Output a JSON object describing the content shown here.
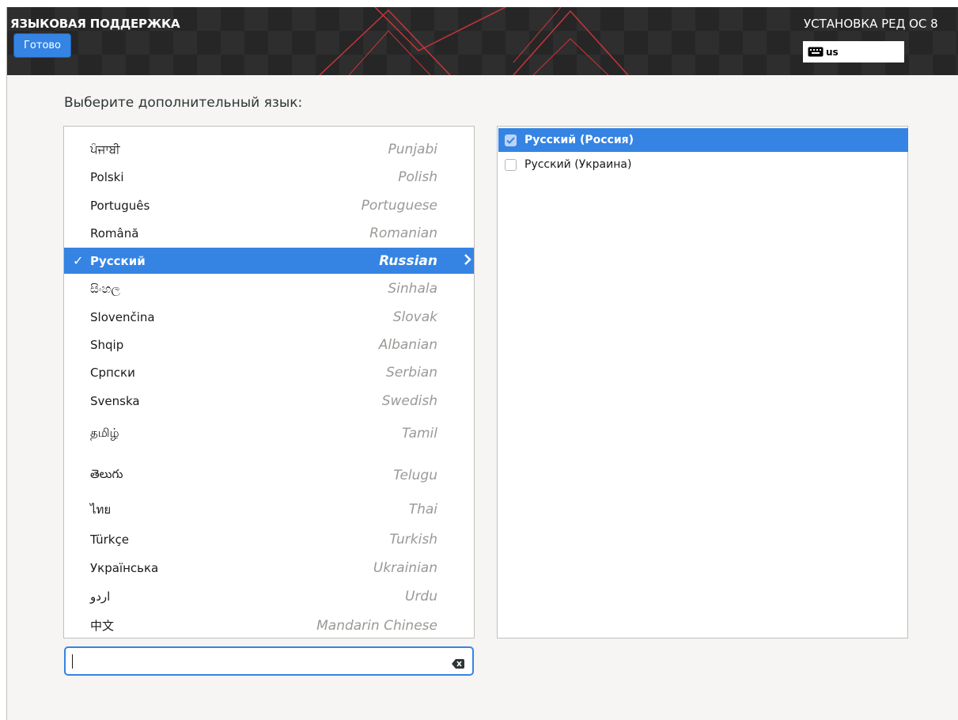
{
  "header": {
    "spoke_title": "ЯЗЫКОВАЯ ПОДДЕРЖКА",
    "done_label": "Готово",
    "product_title": "УСТАНОВКА РЕД ОС 8",
    "keyboard_layout": "us"
  },
  "prompt": "Выберите дополнительный язык:",
  "languages": [
    {
      "native": "ਪੰਜਾਬੀ",
      "english": "Punjabi"
    },
    {
      "native": "Polski",
      "english": "Polish"
    },
    {
      "native": "Português",
      "english": "Portuguese"
    },
    {
      "native": "Română",
      "english": "Romanian"
    },
    {
      "native": "Русский",
      "english": "Russian",
      "check": "✓",
      "chevron": "›"
    },
    {
      "native": "සිංහල",
      "english": "Sinhala"
    },
    {
      "native": "Slovenčina",
      "english": "Slovak"
    },
    {
      "native": "Shqip",
      "english": "Albanian"
    },
    {
      "native": "Српски",
      "english": "Serbian"
    },
    {
      "native": "Svenska",
      "english": "Swedish"
    },
    {
      "native": "தமிழ்",
      "english": "Tamil"
    },
    {
      "native": "తెలుగు",
      "english": "Telugu"
    },
    {
      "native": "ไทย",
      "english": "Thai"
    },
    {
      "native": "Türkçe",
      "english": "Turkish"
    },
    {
      "native": "Українська",
      "english": "Ukrainian"
    },
    {
      "native": "اردو",
      "english": "Urdu"
    },
    {
      "native": "中文",
      "english": "Mandarin Chinese"
    }
  ],
  "locales": [
    {
      "label": "Русский (Россия)",
      "checked": true
    },
    {
      "label": "Русский (Украина)",
      "checked": false
    }
  ],
  "search": {
    "value": ""
  },
  "colors": {
    "accent": "#3584e4",
    "header_bg": "#2e2e2e",
    "deco_red": "#e01b24"
  }
}
